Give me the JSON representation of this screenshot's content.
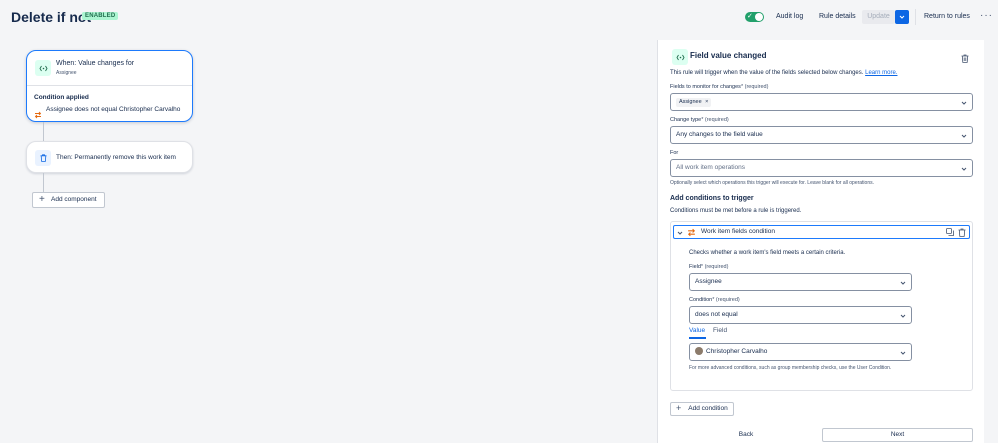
{
  "header": {
    "title": "Delete if not",
    "status_badge": "ENABLED",
    "audit_log": "Audit log",
    "rule_details": "Rule details",
    "update": "Update",
    "return_to_rules": "Return to rules",
    "more": "···",
    "rule_enabled": true
  },
  "canvas": {
    "trigger": {
      "title": "When: Value changes for",
      "subtitle": "Assignee",
      "condition_title": "Condition applied",
      "condition_text": "Assignee does not equal Christopher Carvalho"
    },
    "action": {
      "text": "Then: Permanently remove this work item"
    },
    "add_component": "Add component"
  },
  "panel": {
    "title": "Field value changed",
    "description": "This rule will trigger when the value of the fields selected below changes.",
    "learn_more": "Learn more.",
    "fields_label": "Fields to monitor for changes",
    "fields_req": "* (required)",
    "fields_tag": "Assignee",
    "fields_tag_remove": "×",
    "change_type_label": "Change type",
    "change_type_req": "* (required)",
    "change_type_value": "Any changes to the field value",
    "for_label": "For",
    "for_placeholder": "All work item operations",
    "for_help": "Optionally select which operations this trigger will execute for. Leave blank for all operations.",
    "conditions_title": "Add conditions to trigger",
    "conditions_desc": "Conditions must be met before a rule is triggered.",
    "condition": {
      "title": "Work item fields condition",
      "desc": "Checks whether a work item's field meets a certain criteria.",
      "field_label": "Field",
      "field_req": "* (required)",
      "field_value": "Assignee",
      "cond_label": "Condition",
      "cond_req": "* (required)",
      "cond_value": "does not equal",
      "tab_value": "Value",
      "tab_field": "Field",
      "value_selected": "Christopher Carvalho",
      "help": "For more advanced conditions, such as group membership checks, use the User Condition."
    },
    "add_condition": "Add condition",
    "back": "Back",
    "next": "Next"
  },
  "colors": {
    "accent": "#0c66e4",
    "selected_border": "#1d7afc",
    "toggle_on": "#22a06b",
    "badge_bg": "#abf5d1",
    "badge_text": "#216e4e"
  }
}
